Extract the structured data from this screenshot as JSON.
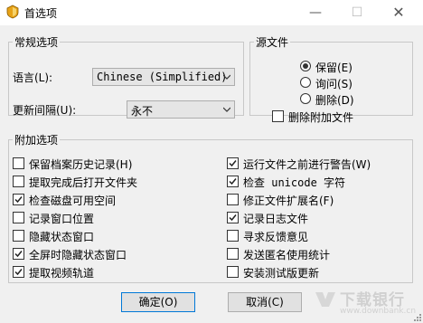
{
  "window": {
    "title": "首选项",
    "minimize": "—",
    "maximize": "☐",
    "close": "✕"
  },
  "general": {
    "legend": "常规选项",
    "language_label": "语言(L):",
    "language_value": "Chinese (Simplified)",
    "update_label": "更新间隔(U):",
    "update_value": "永不"
  },
  "source": {
    "legend": "源文件",
    "options": [
      {
        "label": "保留(E)",
        "selected": true
      },
      {
        "label": "询问(S)",
        "selected": false
      },
      {
        "label": "删除(D)",
        "selected": false
      }
    ],
    "delete_extra": {
      "label": "删除附加文件",
      "checked": false
    }
  },
  "extra": {
    "legend": "附加选项",
    "left": [
      {
        "label": "保留档案历史记录(H)",
        "checked": false
      },
      {
        "label": "提取完成后打开文件夹",
        "checked": false
      },
      {
        "label": "检查磁盘可用空间",
        "checked": true
      },
      {
        "label": "记录窗口位置",
        "checked": false
      },
      {
        "label": "隐藏状态窗口",
        "checked": false
      },
      {
        "label": "全屏时隐藏状态窗口",
        "checked": true
      },
      {
        "label": "提取视频轨道",
        "checked": true
      }
    ],
    "right": [
      {
        "label": "运行文件之前进行警告(W)",
        "checked": true
      },
      {
        "label": "检查 unicode 字符",
        "checked": true
      },
      {
        "label": "修正文件扩展名(F)",
        "checked": false
      },
      {
        "label": "记录日志文件",
        "checked": true
      },
      {
        "label": "寻求反馈意见",
        "checked": false
      },
      {
        "label": "发送匿名使用统计",
        "checked": false
      },
      {
        "label": "安装测试版更新",
        "checked": false
      }
    ]
  },
  "buttons": {
    "ok": "确定(O)",
    "cancel": "取消(C)"
  },
  "watermark": {
    "name": "下载银行",
    "url": "www.downbank.cn"
  },
  "colors": {
    "accent": "#0078d7",
    "border": "#adadad",
    "background": "#f0f0f0"
  }
}
